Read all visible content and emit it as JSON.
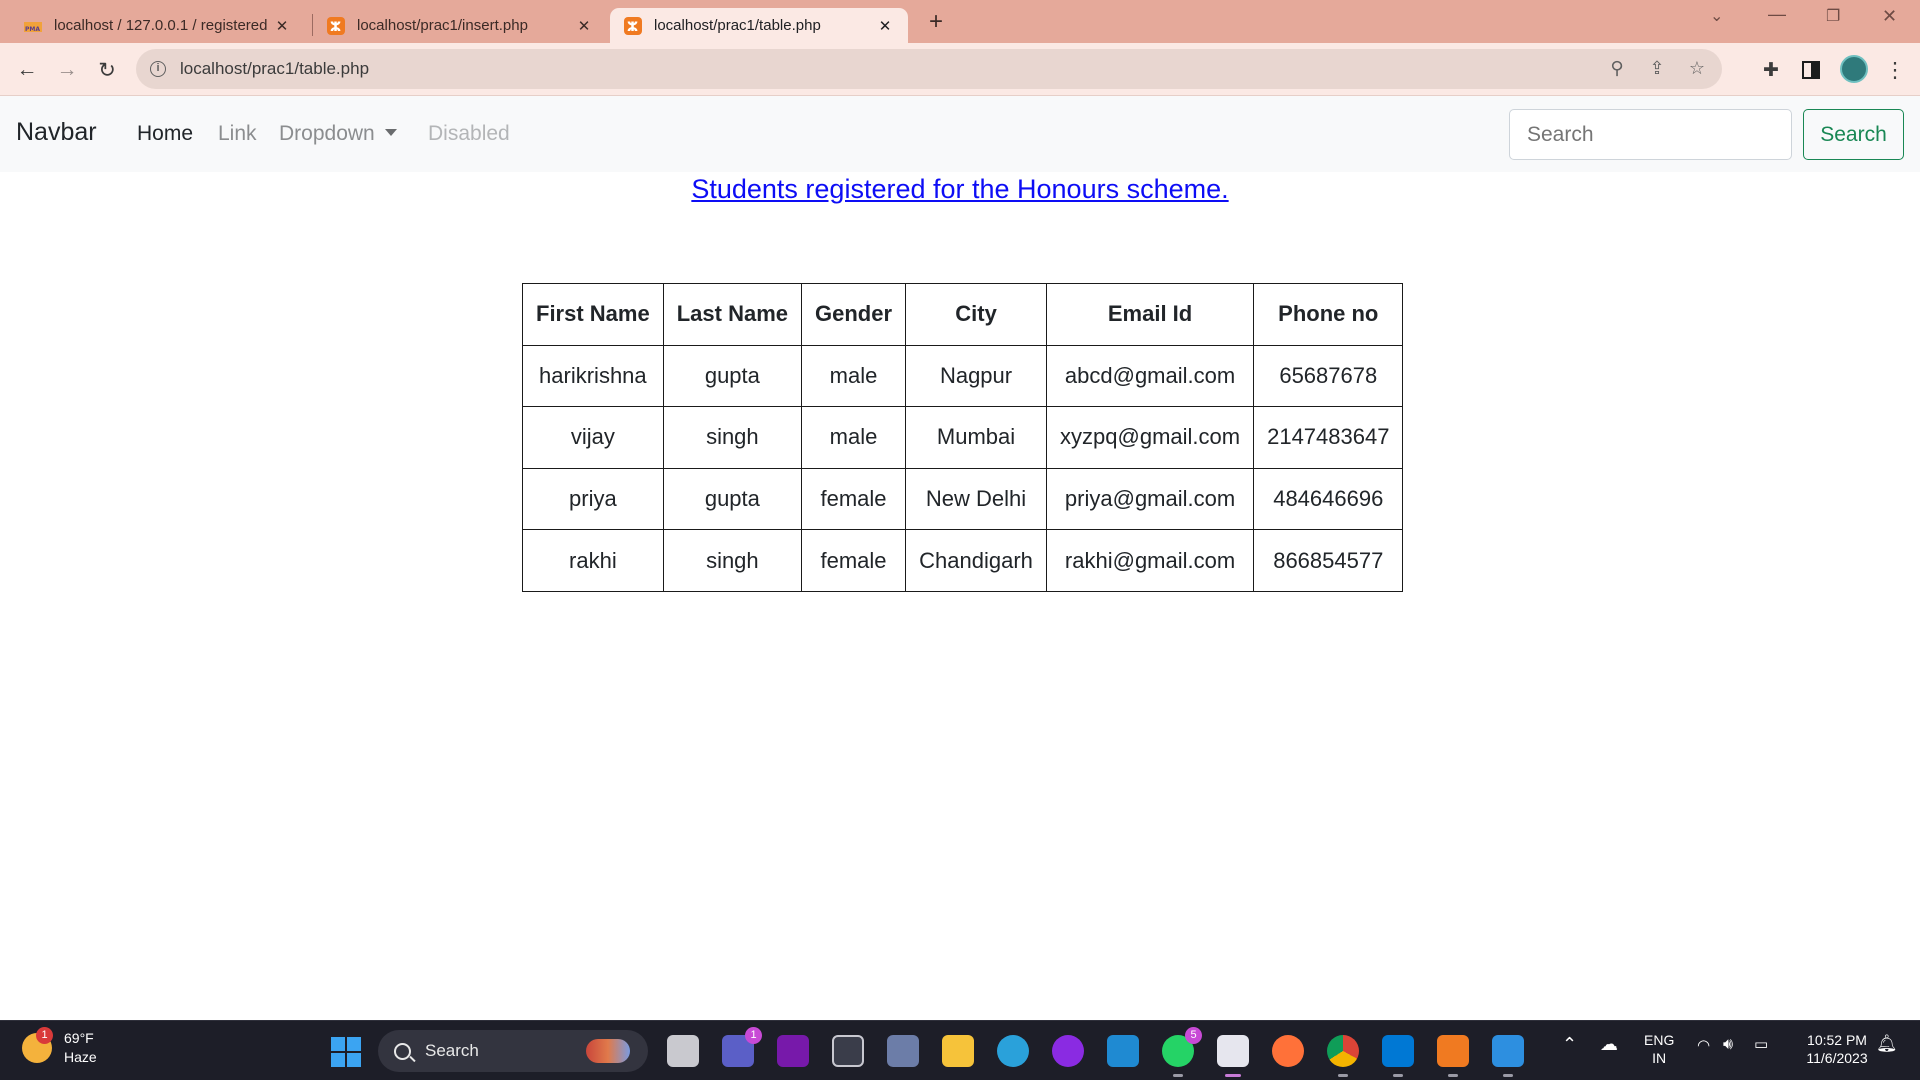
{
  "browser": {
    "tabs": [
      {
        "title": "localhost / 127.0.0.1 / registered",
        "favicon": "phpmyadmin-icon",
        "active": false
      },
      {
        "title": "localhost/prac1/insert.php",
        "favicon": "xampp-icon",
        "active": false
      },
      {
        "title": "localhost/prac1/table.php",
        "favicon": "xampp-icon",
        "active": true
      }
    ],
    "url": "localhost/prac1/table.php"
  },
  "navbar": {
    "brand": "Navbar",
    "links": {
      "home": "Home",
      "link": "Link",
      "dropdown": "Dropdown",
      "disabled": "Disabled"
    },
    "search_placeholder": "Search",
    "search_button": "Search"
  },
  "page": {
    "heading": "Students registered for the Honours scheme.",
    "table": {
      "headers": [
        "First Name",
        "Last Name",
        "Gender",
        "City",
        "Email Id",
        "Phone no"
      ],
      "rows": [
        [
          "harikrishna",
          "gupta",
          "male",
          "Nagpur",
          "abcd@gmail.com",
          "65687678"
        ],
        [
          "vijay",
          "singh",
          "male",
          "Mumbai",
          "xyzpq@gmail.com",
          "2147483647"
        ],
        [
          "priya",
          "gupta",
          "female",
          "New Delhi",
          "priya@gmail.com",
          "484646696"
        ],
        [
          "rakhi",
          "singh",
          "female",
          "Chandigarh",
          "rakhi@gmail.com",
          "866854577"
        ]
      ]
    }
  },
  "taskbar": {
    "weather": {
      "temp": "69°F",
      "condition": "Haze",
      "badge": "1"
    },
    "search_label": "Search",
    "teams_badge": "1",
    "whatsapp_badge": "5",
    "language": {
      "line1": "ENG",
      "line2": "IN"
    },
    "clock": {
      "time": "10:52 PM",
      "date": "11/6/2023"
    }
  },
  "colors": {
    "tab_strip": "#e5a99a",
    "link_blue": "#0d0df5",
    "search_green": "#198754",
    "taskbar": "#1d1e28"
  }
}
